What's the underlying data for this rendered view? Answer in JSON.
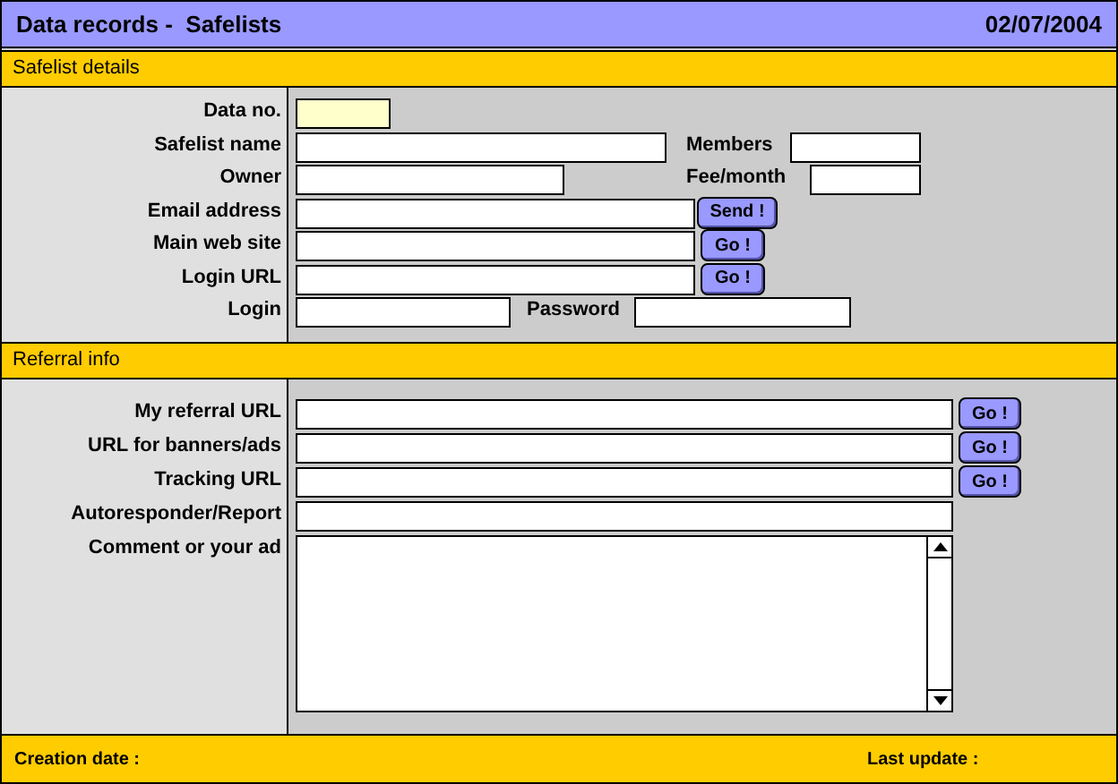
{
  "window": {
    "title": "Data records -  Safelists",
    "date": "02/07/2004"
  },
  "sections": [
    {
      "title": "Safelist details",
      "rows": [
        {
          "label": "Data no.",
          "items": [
            {
              "kind": "input",
              "highlighted": true
            }
          ]
        },
        {
          "label": "Safelist name",
          "items": [
            {
              "kind": "input",
              "highlighted": false
            },
            {
              "kind": "label",
              "text": "Members"
            },
            {
              "kind": "input",
              "highlighted": false
            }
          ]
        },
        {
          "label": "Owner",
          "items": [
            {
              "kind": "input",
              "highlighted": false
            },
            {
              "kind": "label",
              "text": "Fee/month"
            },
            {
              "kind": "input",
              "highlighted": false
            }
          ]
        },
        {
          "label": "Email address",
          "items": [
            {
              "kind": "input",
              "highlighted": false
            },
            {
              "kind": "button",
              "text": "Send !"
            }
          ]
        },
        {
          "label": "Main web site",
          "items": [
            {
              "kind": "input",
              "highlighted": false
            },
            {
              "kind": "button",
              "text": "Go !"
            }
          ]
        },
        {
          "label": "Login URL",
          "items": [
            {
              "kind": "input",
              "highlighted": false
            },
            {
              "kind": "button",
              "text": "Go !"
            }
          ]
        },
        {
          "label": "Login",
          "items": [
            {
              "kind": "input",
              "highlighted": false
            },
            {
              "kind": "label",
              "text": "Password"
            },
            {
              "kind": "input",
              "highlighted": false
            }
          ]
        }
      ]
    },
    {
      "title": "Referral info",
      "rows": [
        {
          "label": "My referral URL",
          "items": [
            {
              "kind": "input",
              "highlighted": false
            },
            {
              "kind": "button",
              "text": "Go !"
            }
          ]
        },
        {
          "label": "URL for banners/ads",
          "items": [
            {
              "kind": "input",
              "highlighted": false
            },
            {
              "kind": "button",
              "text": "Go !"
            }
          ]
        },
        {
          "label": "Tracking URL",
          "items": [
            {
              "kind": "input",
              "highlighted": false
            },
            {
              "kind": "button",
              "text": "Go !"
            }
          ]
        },
        {
          "label": "Autoresponder/Report",
          "items": [
            {
              "kind": "input",
              "highlighted": false
            }
          ]
        },
        {
          "label": "Comment or your ad",
          "items": [
            {
              "kind": "textarea"
            }
          ]
        }
      ]
    }
  ],
  "footer": {
    "created": "Creation date :",
    "updated": "Last update :"
  }
}
